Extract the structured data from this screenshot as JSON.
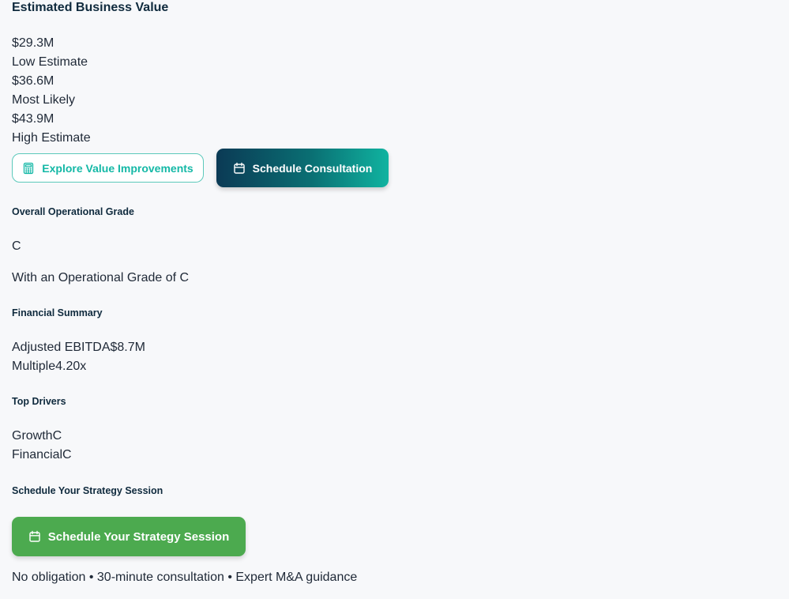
{
  "valuation": {
    "title": "Estimated Business Value",
    "low_value": "$29.3M",
    "low_label": "Low Estimate",
    "likely_value": "$36.6M",
    "likely_label": "Most Likely",
    "high_value": "$43.9M",
    "high_label": "High Estimate"
  },
  "actions": {
    "explore_label": "Explore Value Improvements",
    "explore_icon": "calculator-icon",
    "schedule_label": "Schedule Consultation",
    "schedule_icon": "calendar-icon"
  },
  "grade": {
    "heading": "Overall Operational Grade",
    "value": "C",
    "description": "With an Operational Grade of C"
  },
  "financial": {
    "heading": "Financial Summary",
    "ebitda_line": "Adjusted EBITDA$8.7M",
    "multiple_line": "Multiple4.20x"
  },
  "drivers": {
    "heading": "Top Drivers",
    "items": [
      "GrowthC",
      "FinancialC"
    ]
  },
  "strategy": {
    "heading": "Schedule Your Strategy Session",
    "button_label": "Schedule Your Strategy Session",
    "button_icon": "calendar-icon",
    "footnote": "No obligation • 30-minute consultation • Expert M&A guidance"
  },
  "colors": {
    "teal_accent": "#14b8a6",
    "dark_navy": "#0b3a55",
    "green_cta": "#4caa4f",
    "background": "#f7f8fa"
  }
}
